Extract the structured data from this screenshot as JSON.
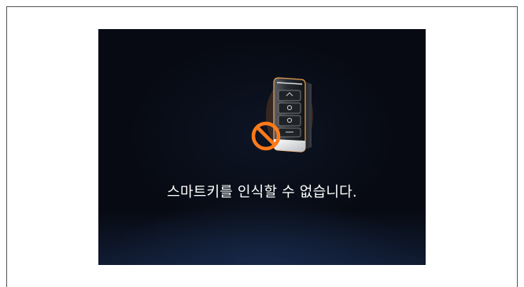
{
  "screen": {
    "message": "스마트키를 인식할 수 없습니다.",
    "icon": "smart-key-with-prohibited-sign",
    "colors": {
      "background": "#070a12",
      "prohibited_sign": "#ff7a1a",
      "text": "#ffffff"
    }
  }
}
